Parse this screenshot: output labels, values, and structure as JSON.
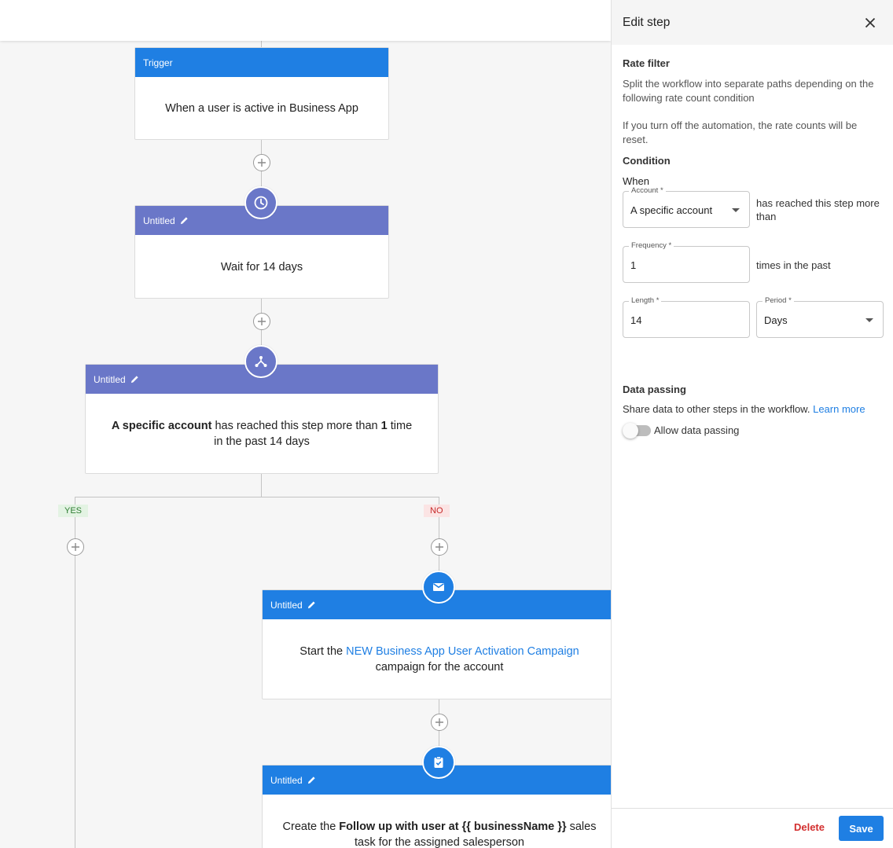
{
  "workflow": {
    "trigger": {
      "header": "Trigger",
      "text": "When a user is active in Business App"
    },
    "wait": {
      "header": "Untitled",
      "text": "Wait for 14 days"
    },
    "rate_filter": {
      "header": "Untitled",
      "bold1": "A specific account",
      "text1": " has reached this step more than ",
      "bold2": "1",
      "text2": " time in the past 14 days"
    },
    "branches": {
      "yes": "YES",
      "no": "NO"
    },
    "campaign": {
      "header": "Untitled",
      "prefix": "Start the ",
      "link": "NEW Business App User Activation Campaign",
      "suffix": " campaign for the account"
    },
    "task": {
      "header": "Untitled",
      "prefix": "Create the ",
      "bold": "Follow up with user at {{ businessName }}",
      "suffix": " sales task for the assigned salesperson"
    }
  },
  "panel": {
    "title": "Edit step",
    "section_title": "Rate filter",
    "desc1": "Split the workflow into separate paths depending on the following rate count condition",
    "desc2": "If you turn off the automation, the rate counts will be reset.",
    "condition_title": "Condition",
    "when": "When",
    "account_label": "Account *",
    "account_value": "A specific account",
    "account_after": "has reached this step more than",
    "frequency_label": "Frequency *",
    "frequency_value": "1",
    "frequency_after": "times in the past",
    "length_label": "Length *",
    "length_value": "14",
    "period_label": "Period *",
    "period_value": "Days",
    "data_passing_title": "Data passing",
    "data_passing_desc": "Share data to other steps in the workflow.",
    "learn_more": "Learn more",
    "allow_label": "Allow data passing",
    "allow_enabled": false,
    "delete_label": "Delete",
    "save_label": "Save"
  },
  "colors": {
    "accent": "#1f7fe3",
    "purple": "#6a77c8",
    "danger": "#d32f2f"
  }
}
